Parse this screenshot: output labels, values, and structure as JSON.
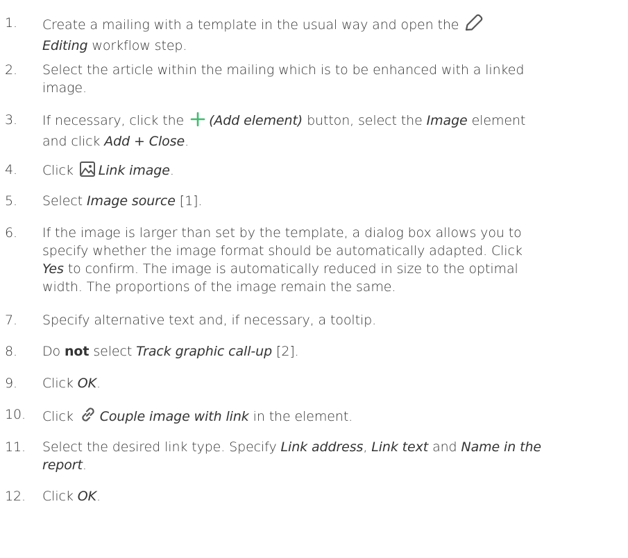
{
  "steps": [
    {
      "num": "1.",
      "parts": [
        "Create a mailing with a template in the usual way and open the ",
        "Editing",
        " workflow step."
      ],
      "icon": "pencil-icon"
    },
    {
      "num": "2.",
      "lines": [
        "Select the article within the mailing which is to be enhanced with a linked",
        "image."
      ]
    },
    {
      "num": "3.",
      "parts": [
        "If necessary, click the ",
        "(Add element)",
        " button, select the ",
        "Image",
        " element",
        "and click ",
        "Add + Close",
        "."
      ],
      "icon": "plus-icon",
      "accent": "#3dbd6e"
    },
    {
      "num": "4.",
      "parts": [
        "Click ",
        "Link image",
        "."
      ],
      "icon": "image-icon"
    },
    {
      "num": "5.",
      "parts": [
        "Select ",
        "Image source",
        " [1]."
      ]
    },
    {
      "num": "6.",
      "lines": [
        "If the image is larger than set by the template, a dialog box allows you to",
        "specify whether the image format should be automatically adapted. Click",
        " to confirm. The image is automatically reduced in size to the optimal",
        "width. The proportions of the image remain the same."
      ],
      "italic": "Yes"
    },
    {
      "num": "7.",
      "text": "Specify alternative text and, if necessary, a tooltip."
    },
    {
      "num": "8.",
      "parts": [
        "Do ",
        "not",
        " select ",
        "Track graphic call-up",
        " [2]."
      ]
    },
    {
      "num": "9.",
      "parts": [
        "Click ",
        "OK",
        "."
      ]
    },
    {
      "num": "10.",
      "parts": [
        "Click ",
        "Couple image with link",
        " in the element."
      ],
      "icon": "link-icon"
    },
    {
      "num": "11.",
      "parts": [
        "Select the desired link type. Specify ",
        "Link address",
        ", ",
        "Link text",
        " and ",
        "Name in the",
        "report",
        "."
      ]
    },
    {
      "num": "12.",
      "parts": [
        "Click ",
        "OK",
        "."
      ]
    }
  ]
}
